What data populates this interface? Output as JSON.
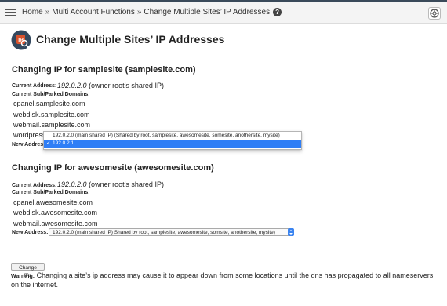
{
  "breadcrumb": {
    "home": "Home",
    "section": "Multi Account Functions",
    "page": "Change Multiple Sites’ IP Addresses",
    "separator": "»"
  },
  "page_title": "Change Multiple Sites’ IP Addresses",
  "labels": {
    "current_address": "Current Address:",
    "current_domains": "Current Sub/Parked Domains:",
    "new_address": "New Address:"
  },
  "sites": [
    {
      "heading": "Changing IP for samplesite (samplesite.com)",
      "current_ip": "192.0.2.0",
      "current_ip_note": "(owner root’s shared IP)",
      "domains": [
        "cpanel.samplesite.com",
        "webdisk.samplesite.com",
        "webmail.samplesite.com",
        "wordpress"
      ],
      "dropdown_options": [
        "192.0.2.0 (main shared IP) (Shared by root, samplesite, awesomesite, somesite, anothersite, mysite)",
        "192.0.2.1"
      ],
      "selected_check": "✓"
    },
    {
      "heading": "Changing IP for awesomesite (awesomesite.com)",
      "current_ip": "192.0.2.0",
      "current_ip_note": "(owner root’s shared IP)",
      "domains": [
        "cpanel.awesomesite.com",
        "webdisk.awesomesite.com",
        "webmail.awesomesite.com"
      ],
      "select_value": "192.0.2.0 (main shared IP) Shared by root, samplesite, awesomesite, somsite, anothersite, mysite)"
    }
  ],
  "submit_label": "Change IPs",
  "warning": {
    "label": "Warning:",
    "text": "Changing a site’s ip address may cause it to appear down from some locations until the dns has propagated to all nameservers on the internet."
  },
  "icons": {
    "menu": "hamburger-menu-icon",
    "help": "help-icon",
    "support": "lifebuoy-icon",
    "page": "ip-address-icon"
  },
  "colors": {
    "accent": "#2f7ef6",
    "topbar_border": "#3a4a5a",
    "page_icon_bg": "#33485e",
    "page_icon_accent": "#d9522c"
  }
}
